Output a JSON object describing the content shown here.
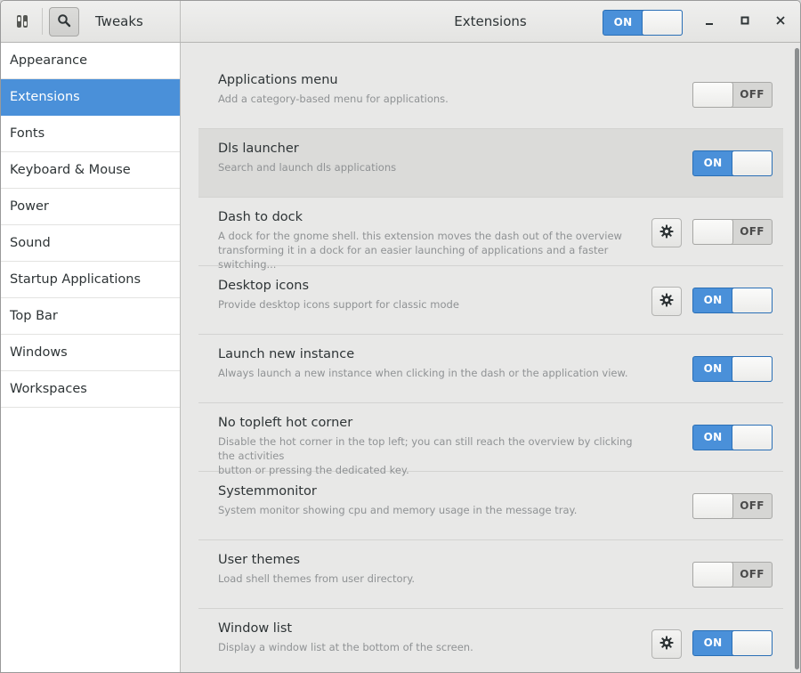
{
  "header": {
    "app_title": "Tweaks",
    "window_title": "Extensions",
    "master_switch": "ON"
  },
  "icons": {
    "app": "tweaks-app-icon",
    "search": "search-icon",
    "gear": "gear-icon",
    "minimize": "minimize-icon",
    "maximize": "maximize-icon",
    "close": "close-icon"
  },
  "colors": {
    "accent": "#4a90d9",
    "selected_text": "#ffffff"
  },
  "sidebar": {
    "items": [
      {
        "label": "Appearance"
      },
      {
        "label": "Extensions"
      },
      {
        "label": "Fonts"
      },
      {
        "label": "Keyboard & Mouse"
      },
      {
        "label": "Power"
      },
      {
        "label": "Sound"
      },
      {
        "label": "Startup Applications"
      },
      {
        "label": "Top Bar"
      },
      {
        "label": "Windows"
      },
      {
        "label": "Workspaces"
      }
    ],
    "selected": "Extensions"
  },
  "extensions": [
    {
      "title": "Applications menu",
      "desc": "Add a category-based menu for applications.",
      "state": "OFF"
    },
    {
      "title": "Dls launcher",
      "desc": "Search and launch dls applications",
      "state": "ON"
    },
    {
      "title": "Dash to dock",
      "desc": "A dock for the gnome shell. this extension moves the dash out of the overview\ntransforming it in a dock for an easier launching of applications and a faster switching...",
      "state": "OFF"
    },
    {
      "title": "Desktop icons",
      "desc": "Provide desktop icons support for classic mode",
      "state": "ON"
    },
    {
      "title": "Launch new instance",
      "desc": "Always launch a new instance when clicking in the dash or the application view.",
      "state": "ON"
    },
    {
      "title": "No topleft hot corner",
      "desc": "Disable the hot corner in the top left; you can still reach the overview by clicking the activities\nbutton or pressing the dedicated key.",
      "state": "ON"
    },
    {
      "title": "Systemmonitor",
      "desc": "System monitor showing cpu and memory usage in the message tray.",
      "state": "OFF"
    },
    {
      "title": "User themes",
      "desc": "Load shell themes from user directory.",
      "state": "OFF"
    },
    {
      "title": "Window list",
      "desc": "Display a window list at the bottom of the screen.",
      "state": "ON"
    }
  ]
}
